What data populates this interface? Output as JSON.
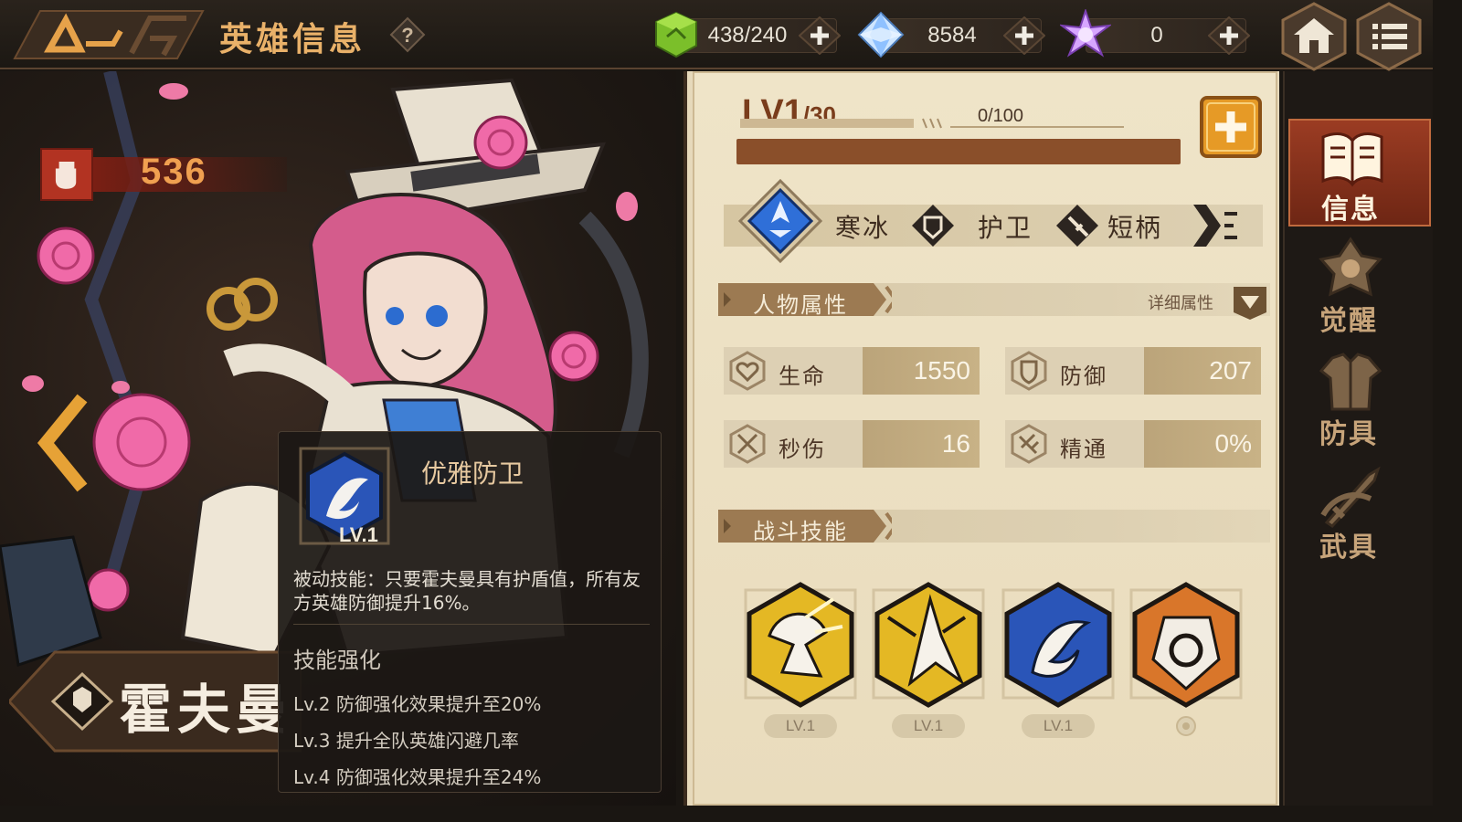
{
  "header": {
    "title": "英雄信息",
    "resources": [
      {
        "icon": "stamina-cube-icon",
        "value": "438/240"
      },
      {
        "icon": "blue-crystal-icon",
        "value": "8584"
      },
      {
        "icon": "purple-crystal-icon",
        "value": "0"
      }
    ]
  },
  "hero": {
    "power": "536",
    "name": "霍夫曼",
    "level": {
      "current": "LV1",
      "max": "/30",
      "exp": "0/100",
      "exp_fraction": 0
    },
    "tags": [
      "寒冰",
      "护卫",
      "短柄"
    ]
  },
  "attributes": {
    "section_title": "人物属性",
    "detail_label": "详细属性",
    "stats": [
      {
        "name": "生命",
        "value": "1550",
        "icon": "heart-shield-icon"
      },
      {
        "name": "防御",
        "value": "207",
        "icon": "defense-shield-icon"
      },
      {
        "name": "秒伤",
        "value": "16",
        "icon": "crossed-swords-icon"
      },
      {
        "name": "精通",
        "value": "0%",
        "icon": "mastery-icon"
      }
    ]
  },
  "skills": {
    "section_title": "战斗技能",
    "items": [
      {
        "icon": "yellow-knight-skill-icon",
        "level": "LV.1"
      },
      {
        "icon": "yellow-strike-skill-icon",
        "level": "LV.1"
      },
      {
        "icon": "blue-feather-skill-icon",
        "level": "LV.1"
      },
      {
        "icon": "orange-shield-skill-icon",
        "level": ""
      }
    ]
  },
  "tooltip": {
    "level": "LV.1",
    "name": "优雅防卫",
    "description": "被动技能：只要霍夫曼具有护盾值，所有友方英雄防御提升16%。",
    "enhance_title": "技能强化",
    "enhancements": [
      "Lv.2 防御强化效果提升至20%",
      "Lv.3 提升全队英雄闪避几率",
      "Lv.4 防御强化效果提升至24%"
    ]
  },
  "tabs": [
    {
      "label": "信息",
      "icon": "book-icon",
      "active": true
    },
    {
      "label": "觉醒",
      "icon": "awaken-emblem-icon",
      "active": false
    },
    {
      "label": "防具",
      "icon": "armor-icon",
      "active": false
    },
    {
      "label": "武具",
      "icon": "weapon-icon",
      "active": false
    }
  ],
  "colors": {
    "accent": "#e9b169",
    "panel": "#efe4c8",
    "active_tab": "#9b3c23",
    "exp_bar": "#8a4f2a"
  }
}
